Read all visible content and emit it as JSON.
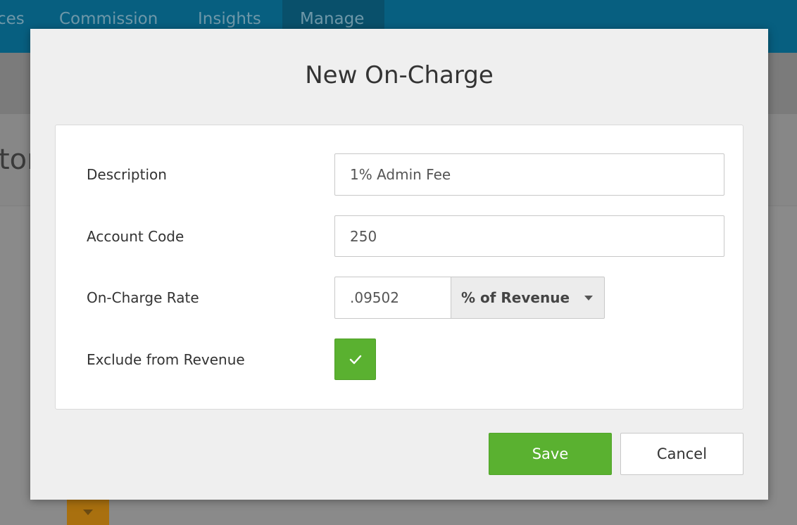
{
  "nav": {
    "items": [
      {
        "label": "ces"
      },
      {
        "label": "Commission"
      },
      {
        "label": "Insights"
      },
      {
        "label": "Manage"
      }
    ]
  },
  "background": {
    "heading_fragment": "tor"
  },
  "modal": {
    "title": "New On-Charge",
    "fields": {
      "description": {
        "label": "Description",
        "value": "1% Admin Fee"
      },
      "account_code": {
        "label": "Account Code",
        "value": "250"
      },
      "rate": {
        "label": "On-Charge Rate",
        "value": ".09502",
        "unit_selected": "% of Revenue"
      },
      "exclude": {
        "label": "Exclude from Revenue",
        "checked": true,
        "check_icon": "checkmark-icon"
      }
    },
    "buttons": {
      "save": "Save",
      "cancel": "Cancel"
    }
  },
  "colors": {
    "primary_green": "#5ab130",
    "topbar": "#075f80"
  }
}
